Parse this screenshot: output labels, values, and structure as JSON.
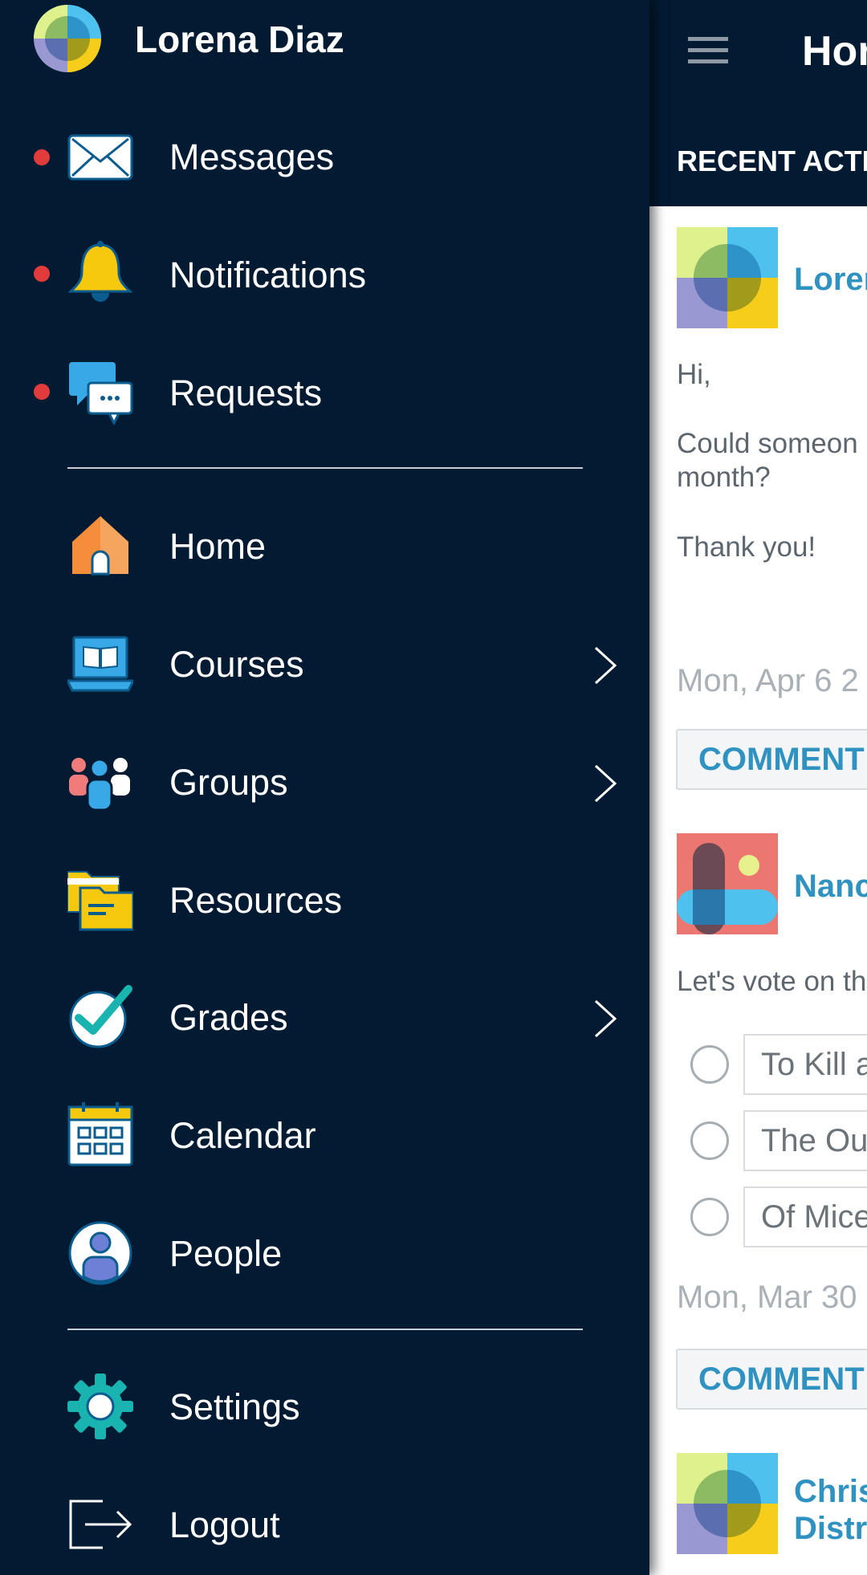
{
  "drawer": {
    "user_name": "Lorena Diaz",
    "dot_color": "#e23b3b",
    "primary_items": [
      {
        "label": "Messages",
        "icon": "envelope-icon",
        "unread": true
      },
      {
        "label": "Notifications",
        "icon": "bell-icon",
        "unread": true
      },
      {
        "label": "Requests",
        "icon": "chat-bubbles-icon",
        "unread": true
      }
    ],
    "secondary_items": [
      {
        "label": "Home",
        "icon": "house-icon",
        "has_submenu": false
      },
      {
        "label": "Courses",
        "icon": "laptop-book-icon",
        "has_submenu": true
      },
      {
        "label": "Groups",
        "icon": "people-group-icon",
        "has_submenu": true
      },
      {
        "label": "Resources",
        "icon": "folders-icon",
        "has_submenu": false
      },
      {
        "label": "Grades",
        "icon": "checkmark-circle-icon",
        "has_submenu": true
      },
      {
        "label": "Calendar",
        "icon": "calendar-icon",
        "has_submenu": false
      },
      {
        "label": "People",
        "icon": "person-icon",
        "has_submenu": false
      }
    ],
    "footer_items": [
      {
        "label": "Settings",
        "icon": "gear-icon"
      },
      {
        "label": "Logout",
        "icon": "logout-icon"
      }
    ]
  },
  "main": {
    "title": "Hor",
    "section_title": "RECENT ACTIV",
    "posts": [
      {
        "author": "Lorer",
        "lines": [
          "Hi,",
          "Could someon",
          "month?",
          "Thank you!"
        ],
        "date": "Mon, Apr 6 2",
        "comment_label": "COMMENT"
      },
      {
        "author": "Nanc",
        "lines": [
          "Let's vote on th"
        ],
        "poll_options": [
          "To Kill a",
          "The Ou",
          "Of Mice"
        ],
        "date": "Mon, Mar 30",
        "comment_label": "COMMENT"
      },
      {
        "author_lines": [
          "Chris",
          "Distr"
        ]
      }
    ]
  }
}
